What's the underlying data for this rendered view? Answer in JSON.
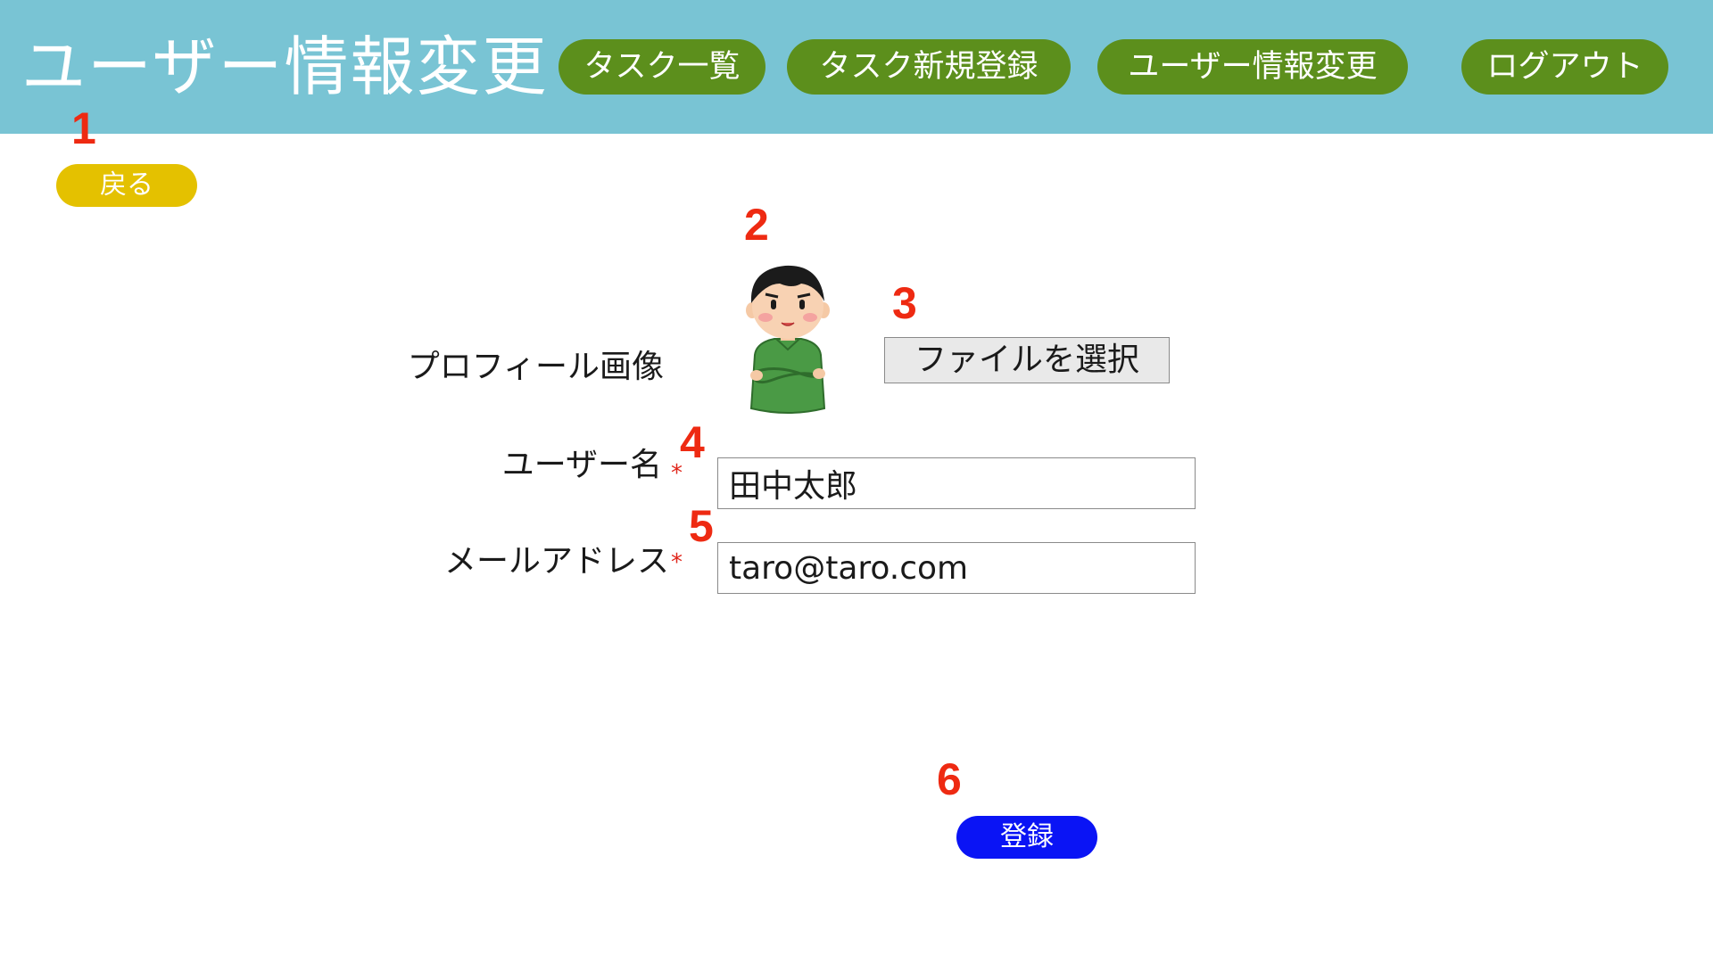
{
  "header": {
    "title": "ユーザー情報変更",
    "nav": [
      {
        "label": "タスク一覧"
      },
      {
        "label": "タスク新規登録"
      },
      {
        "label": "ユーザー情報変更"
      },
      {
        "label": "ログアウト"
      }
    ]
  },
  "annotations": [
    "1",
    "2",
    "3",
    "4",
    "5",
    "6"
  ],
  "back_button": {
    "label": "戻る"
  },
  "form": {
    "profile_image_label": "プロフィール画像",
    "avatar_icon": "person-avatar-icon",
    "file_button_label": "ファイルを選択",
    "username_label": "ユーザー名",
    "username_value": "田中太郎",
    "email_label": "メールアドレス",
    "email_value": "taro@taro.com",
    "required_mark": "*"
  },
  "submit_button": {
    "label": "登録"
  },
  "colors": {
    "header_bg": "#79c4d4",
    "nav_button": "#5c8f1c",
    "back_button": "#e4c100",
    "submit_button": "#0a14f5",
    "annotation": "#ee2a12",
    "required": "#e0251a"
  }
}
